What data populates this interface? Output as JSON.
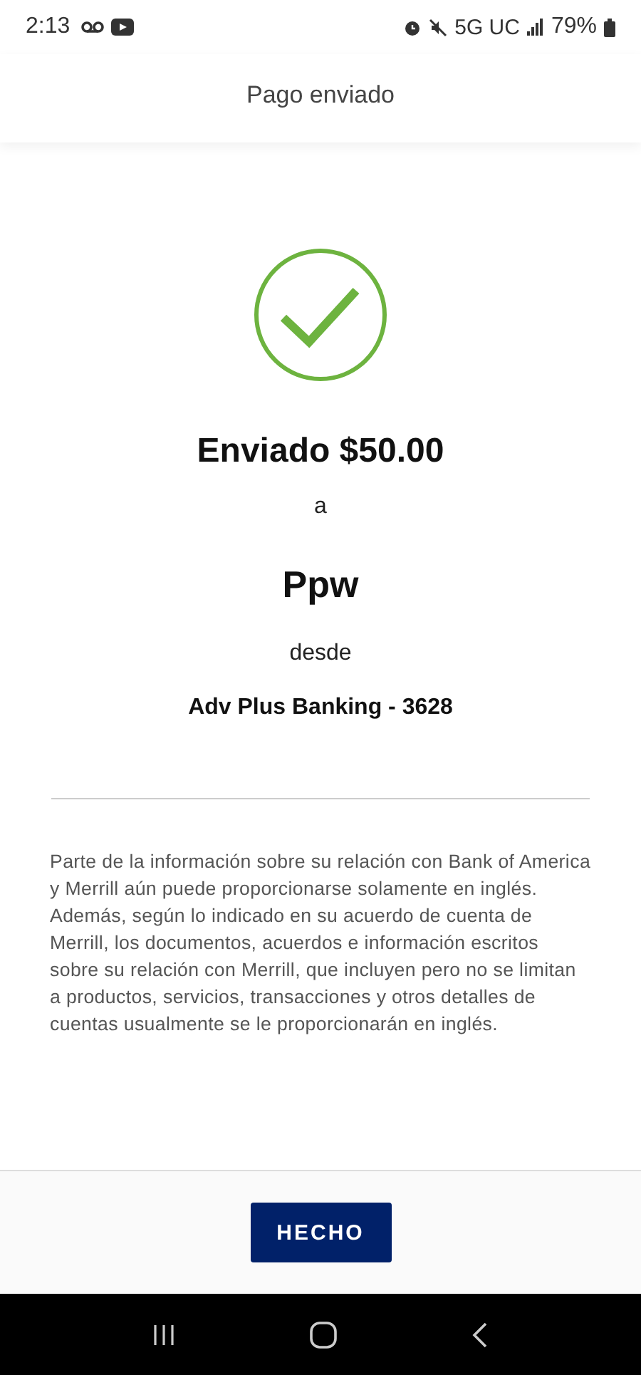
{
  "status_bar": {
    "time": "2:13",
    "network": "5G UC",
    "battery": "79%"
  },
  "header": {
    "title": "Pago enviado"
  },
  "confirmation": {
    "amount_line": "Enviado $50.00",
    "to_word": "a",
    "recipient": "Ppw",
    "from_word": "desde",
    "account": "Adv Plus Banking - 3628"
  },
  "disclaimer": "Parte de la información sobre su relación con Bank of America y Merrill aún puede proporcionarse solamente en inglés. Además, según lo indicado en su acuerdo de cuenta de Merrill, los documentos, acuerdos e información escritos sobre su relación con Merrill, que incluyen pero no se limitan a productos, servicios, transacciones y otros detalles de cuentas usualmente se le proporcionarán en inglés.",
  "buttons": [
    "HECHO"
  ]
}
